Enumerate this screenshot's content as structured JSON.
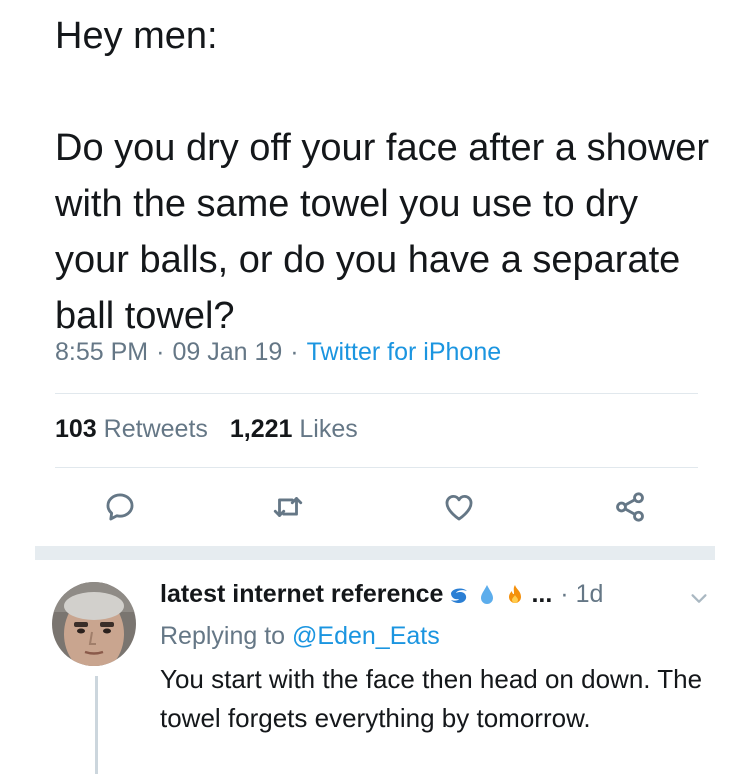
{
  "tweet": {
    "text": "Hey men:\n\nDo you dry off your face after a shower with the same towel you use to dry your balls, or do you have a separate ball towel?",
    "time": "8:55 PM",
    "date": "09 Jan 19",
    "separator": "·",
    "source": "Twitter for iPhone"
  },
  "stats": {
    "retweets_count": "103",
    "retweets_label": "Retweets",
    "likes_count": "1,221",
    "likes_label": "Likes"
  },
  "actions": [
    {
      "icon": "reply-icon"
    },
    {
      "icon": "retweet-icon"
    },
    {
      "icon": "heart-icon"
    },
    {
      "icon": "share-icon"
    }
  ],
  "reply": {
    "name": "latest internet reference",
    "emojis": [
      "cyclone-emoji",
      "droplet-emoji",
      "fire-emoji"
    ],
    "ellipsis": "...",
    "time": "· 1d",
    "replying_prefix": "Replying to",
    "replying_handle": "@Eden_Eats",
    "text": "You start with the face then head on down. The towel forgets everything by tomorrow."
  },
  "colors": {
    "link": "#1b95e0",
    "muted": "#657786",
    "text": "#14171a",
    "divider": "#e1e8ed"
  }
}
